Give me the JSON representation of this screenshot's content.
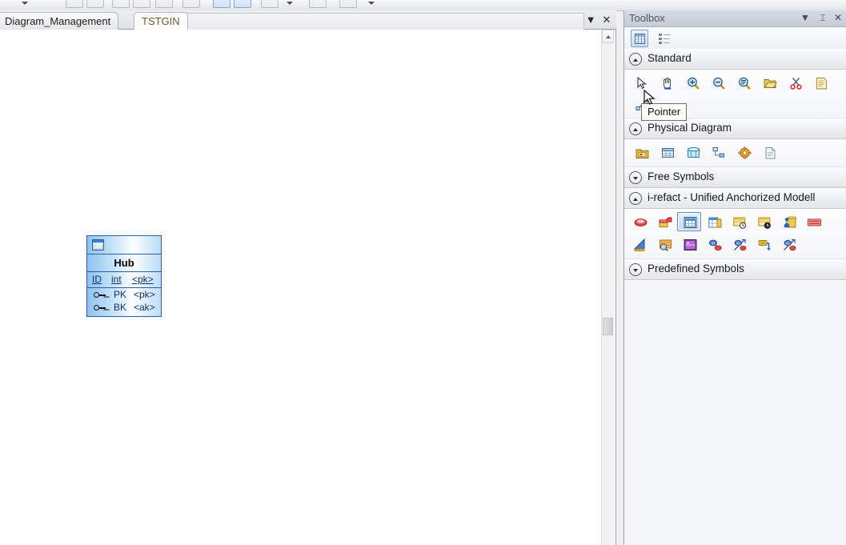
{
  "window": {
    "tabbar": {
      "tabs": [
        {
          "label": "Diagram_Management",
          "active": false
        },
        {
          "label": "TSTGIN",
          "active": true
        }
      ],
      "controls": [
        {
          "name": "tab-list-dropdown",
          "glyph": "▼"
        },
        {
          "name": "close-document",
          "glyph": "✕"
        }
      ]
    }
  },
  "canvas": {
    "entity": {
      "icon": "table-entity-icon",
      "name": "Hub",
      "identifier": {
        "column": "ID",
        "type": "int",
        "key": "<pk>"
      },
      "keys": [
        {
          "icon": "key-icon",
          "name": "PK",
          "type": "<pk>"
        },
        {
          "icon": "key-icon",
          "name": "BK",
          "type": "<ak>"
        }
      ]
    },
    "scrollbar": {
      "up_arrow": "▲"
    }
  },
  "toolbox": {
    "title": "Toolbox",
    "title_controls": [
      {
        "name": "toolbox-menu-dropdown",
        "glyph": "▼"
      },
      {
        "name": "toolbox-pin",
        "glyph": "⌶"
      },
      {
        "name": "toolbox-close",
        "glyph": "✕"
      }
    ],
    "view_buttons": [
      {
        "name": "grid-view-button",
        "selected": true
      },
      {
        "name": "list-view-button",
        "selected": false
      }
    ],
    "tooltip": "Pointer",
    "groups": [
      {
        "name": "Standard",
        "expanded": true,
        "chevron": "up",
        "rows": [
          [
            {
              "name": "pointer-tool",
              "icon": "arrow-pointer-icon"
            },
            {
              "name": "grabber-tool",
              "icon": "hand-grab-icon"
            },
            {
              "name": "zoom-in-tool",
              "icon": "zoom-in-icon"
            },
            {
              "name": "zoom-out-tool",
              "icon": "zoom-out-icon"
            },
            {
              "name": "zoom-fit-tool",
              "icon": "zoom-fit-icon"
            },
            {
              "name": "open-package-tool",
              "icon": "open-folder-icon"
            },
            {
              "name": "cut-tool",
              "icon": "scissors-icon"
            },
            {
              "name": "paste-tool",
              "icon": "document-paste-icon"
            }
          ],
          [
            {
              "name": "link-tool",
              "icon": "link-connector-icon"
            }
          ]
        ]
      },
      {
        "name": "Physical Diagram",
        "expanded": true,
        "chevron": "up",
        "rows": [
          [
            {
              "name": "package-tool",
              "icon": "package-icon"
            },
            {
              "name": "table-tool",
              "icon": "table-icon"
            },
            {
              "name": "view-tool",
              "icon": "database-view-icon"
            },
            {
              "name": "reference-tool",
              "icon": "reference-hierarchy-icon"
            },
            {
              "name": "procedure-tool",
              "icon": "procedure-gear-icon"
            },
            {
              "name": "file-tool",
              "icon": "file-icon"
            }
          ]
        ]
      },
      {
        "name": "Free Symbols",
        "expanded": false,
        "chevron": "down",
        "rows": []
      },
      {
        "name": "i-refact - Unified Anchorized Modell",
        "expanded": true,
        "chevron": "up",
        "rows": [
          [
            {
              "name": "anchor-tool",
              "icon": "red-ellipse-icon"
            },
            {
              "name": "hub-stack-tool",
              "icon": "red-stack-icon"
            },
            {
              "name": "hub-table-tool",
              "icon": "blue-table-window-icon",
              "selected": true
            },
            {
              "name": "link-table-tool",
              "icon": "blue-yellow-table-icon"
            },
            {
              "name": "satellite-history-tool",
              "icon": "yellow-table-clock-icon"
            },
            {
              "name": "satellite-time-tool",
              "icon": "yellow-table-clock2-icon"
            },
            {
              "name": "actor-package-tool",
              "icon": "person-package-icon"
            },
            {
              "name": "red-stripe-tool",
              "icon": "red-striped-bar-icon"
            }
          ],
          [
            {
              "name": "measure-tool",
              "icon": "blue-triangle-ruler-icon"
            },
            {
              "name": "mapping-tool",
              "icon": "orange-table-magnifier-icon"
            },
            {
              "name": "purple-object-tool",
              "icon": "purple-block-icon"
            },
            {
              "name": "relation-tool",
              "icon": "blue-node-link-icon"
            },
            {
              "name": "relation-arrow-tool",
              "icon": "blue-node-arrow-icon"
            },
            {
              "name": "flow-tool",
              "icon": "yellow-flow-arrow-icon"
            },
            {
              "name": "relation-arrow2-tool",
              "icon": "blue-node-arrow2-icon"
            }
          ]
        ]
      },
      {
        "name": "Predefined Symbols",
        "expanded": false,
        "chevron": "down",
        "rows": []
      }
    ]
  }
}
